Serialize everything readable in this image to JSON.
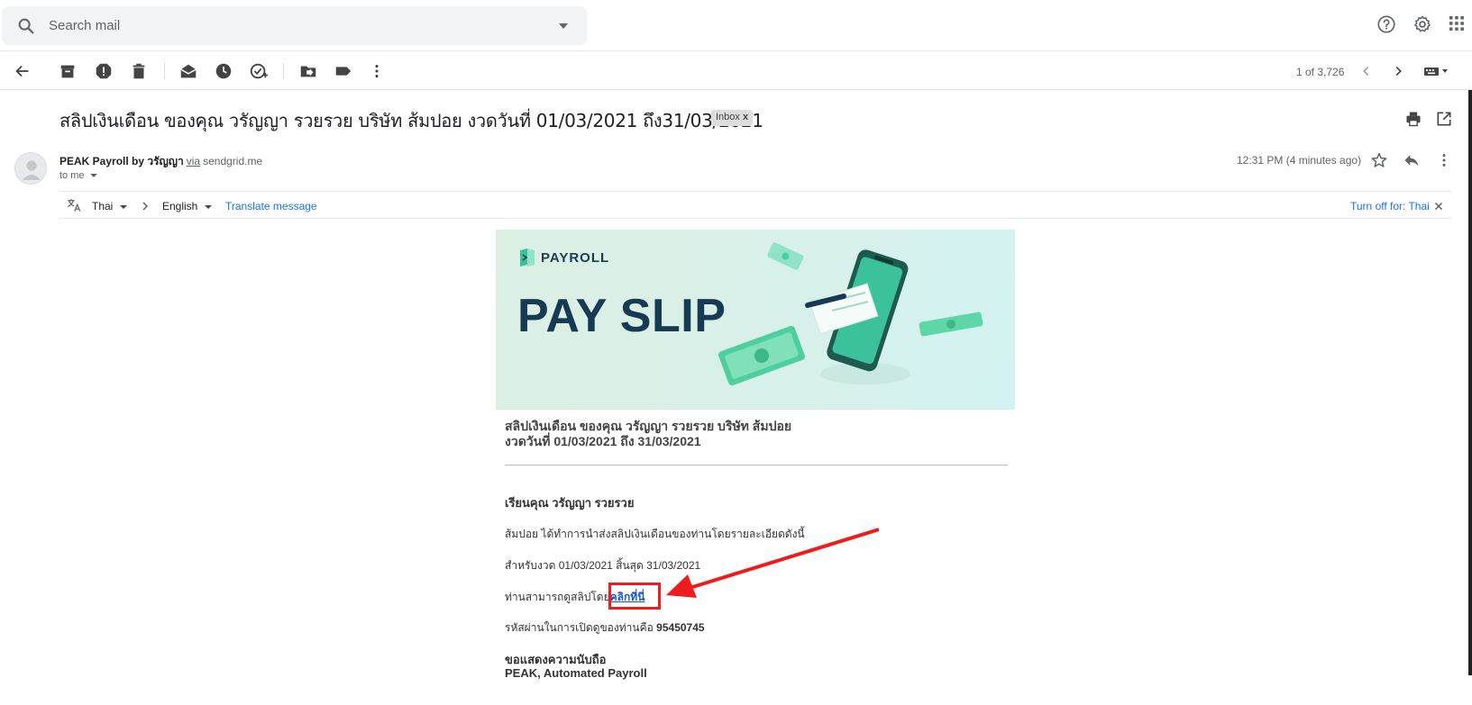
{
  "search": {
    "placeholder": "Search mail"
  },
  "header_icons": [
    "help-icon",
    "settings-icon",
    "apps-icon"
  ],
  "toolbar": {
    "pager": "1 of 3,726"
  },
  "email": {
    "subject": "สลิปเงินเดือน ของคุณ วรัญญา รวยรวย บริษัท ส้มปอย งวดวันที่ 01/03/2021 ถึง31/03/2021",
    "label": "Inbox",
    "label_close": "x",
    "sender_name": "PEAK Payroll by วรัญญา",
    "via": "via",
    "domain": "sendgrid.me",
    "to": "to me",
    "time": "12:31 PM (4 minutes ago)"
  },
  "translate": {
    "from": "Thai",
    "to": "English",
    "action": "Translate message",
    "turn_off": "Turn off for: Thai"
  },
  "body": {
    "banner_brand": "PAYROLL",
    "banner_title": "PAY SLIP",
    "title_line1": "สลิปเงินเดือน ของคุณ วรัญญา รวยรวย บริษัท ส้มปอย",
    "title_line2": "งวดวันที่ 01/03/2021 ถึง 31/03/2021",
    "greeting": "เรียนคุณ วรัญญา รวยรวย",
    "p1": "ส้มปอย ได้ทำการนำส่งสลิปเงินเดือนของท่านโดยรายละเอียดดังนี้",
    "p2": "สำหรับงวด 01/03/2021 สิ้นสุด 31/03/2021",
    "p3_prefix": "ท่านสามารถดูสลิปโดย",
    "p3_link": "คลิกที่นี่",
    "p4_prefix": "รหัสผ่านในการเปิดดูของท่านคือ",
    "p4_password": "95450745",
    "closing": "ขอแสดงความนับถือ",
    "signature": "PEAK, Automated Payroll"
  },
  "colors": {
    "link": "#1a73e8",
    "highlight": "#ee1c1c",
    "banner_text": "#173a53"
  }
}
